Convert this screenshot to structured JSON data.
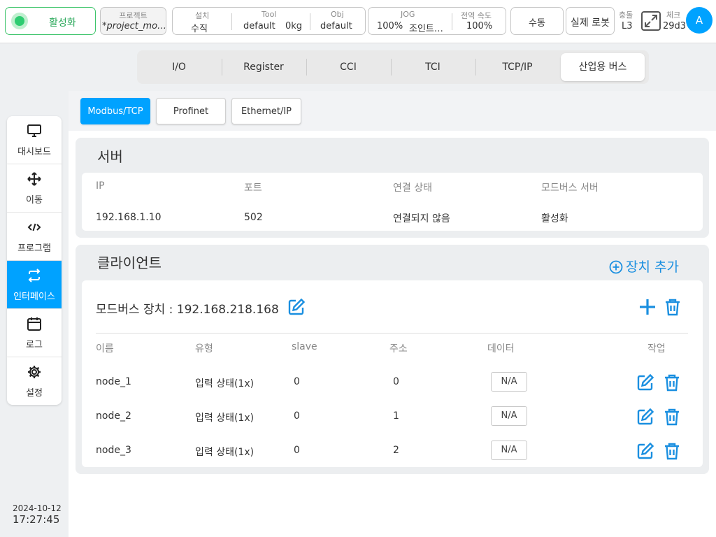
{
  "topbar": {
    "activate_label": "활성화",
    "project": {
      "label": "프로젝트",
      "value": "*project_mo…"
    },
    "install": {
      "label": "설치",
      "value": "수직"
    },
    "tool": {
      "label": "Tool",
      "name": "default",
      "weight": "0kg"
    },
    "obj": {
      "label": "Obj",
      "value": "default"
    },
    "jog": {
      "label": "JOG",
      "percent": "100%",
      "mode": "조인트…"
    },
    "global_speed": {
      "label": "전역 속도",
      "value": "100%"
    },
    "manual_label": "수동",
    "real_robot_label": "실제 로봇",
    "collision": {
      "label": "충돌",
      "value": "L3"
    },
    "check": {
      "label": "체크",
      "value": "29d3"
    },
    "avatar": "A",
    "colors": {
      "accent": "#00a2ff",
      "status_green": "#2ecc71"
    },
    "icons": {
      "status": "status-dot-icon",
      "expand": "expand-icon"
    }
  },
  "sidebar": {
    "items": [
      {
        "label": "대시보드",
        "icon": "monitor-icon"
      },
      {
        "label": "이동",
        "icon": "move-icon"
      },
      {
        "label": "프로그램",
        "icon": "code-icon"
      },
      {
        "label": "인터페이스",
        "icon": "swap-icon",
        "active": true
      },
      {
        "label": "로그",
        "icon": "calendar-icon"
      },
      {
        "label": "설정",
        "icon": "gear-icon"
      }
    ],
    "date": "2024-10-12",
    "time": "17:27:45"
  },
  "tabs": [
    "I/O",
    "Register",
    "CCI",
    "TCI",
    "TCP/IP",
    "산업용 버스"
  ],
  "selected_tab": "산업용 버스",
  "subtabs": [
    "Modbus/TCP",
    "Profinet",
    "Ethernet/IP"
  ],
  "selected_subtab": "Modbus/TCP",
  "server": {
    "title": "서버",
    "headers": [
      "IP",
      "포트",
      "연결 상태",
      "모드버스 서버"
    ],
    "row": [
      "192.168.1.10",
      "502",
      "연결되지 않음",
      "활성화"
    ]
  },
  "client": {
    "title": "클라이언트",
    "add_device_label": "장치 추가",
    "device_title": "모드버스 장치 : 192.168.218.168",
    "headers": [
      "이름",
      "유형",
      "slave",
      "주소",
      "데이터",
      "작업"
    ],
    "rows": [
      {
        "name": "node_1",
        "type": "입력 상태(1x)",
        "slave": "0",
        "address": "0",
        "data": "N/A"
      },
      {
        "name": "node_2",
        "type": "입력 상태(1x)",
        "slave": "0",
        "address": "1",
        "data": "N/A"
      },
      {
        "name": "node_3",
        "type": "입력 상태(1x)",
        "slave": "0",
        "address": "2",
        "data": "N/A"
      }
    ]
  }
}
